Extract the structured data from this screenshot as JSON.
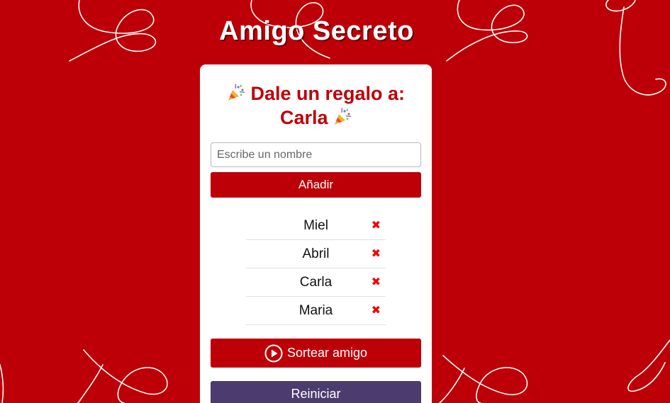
{
  "app": {
    "title": "Amigo Secreto"
  },
  "result": {
    "line1": "Dale un regalo a:",
    "name": "Carla",
    "emoji_icon": "party-popper-icon"
  },
  "input": {
    "placeholder": "Escribe un nombre",
    "value": ""
  },
  "buttons": {
    "add_label": "Añadir",
    "draw_label": "Sortear amigo",
    "draw_icon": "play-circle-icon",
    "reset_label": "Reiniciar"
  },
  "friends": [
    {
      "name": "Miel",
      "remove_icon": "✖"
    },
    {
      "name": "Abril",
      "remove_icon": "✖"
    },
    {
      "name": "Carla",
      "remove_icon": "✖"
    },
    {
      "name": "Maria",
      "remove_icon": "✖"
    }
  ],
  "colors": {
    "background": "#bd0008",
    "primary_button": "#bd0008",
    "reset_button": "#4b3b6e",
    "remove_icon": "#ee0000",
    "result_text": "#bd0008"
  }
}
